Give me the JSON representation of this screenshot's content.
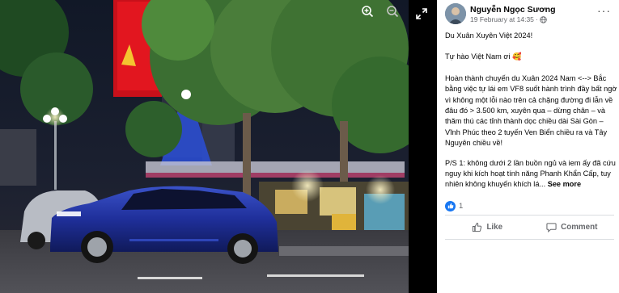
{
  "photo": {
    "icons": [
      "zoom-in-icon",
      "zoom-out-icon",
      "expand-icon"
    ]
  },
  "post": {
    "author": "Nguyễn Ngọc Sương",
    "date": "19 February at 14:35",
    "separator": "·",
    "more_label": "···",
    "paragraphs": [
      "Du Xuân Xuyên Việt 2024!",
      "Tự hào Việt Nam ơi 🥰",
      "Hoàn thành chuyến du Xuân 2024 Nam <--> Bắc bằng việc tự lái em VF8 suốt hành trình đầy bất ngờ vì không một lỗi nào trên cả chặng đường đi lẫn về đâu đó > 3.500 km, xuyên qua – dừng chân – và thăm thú các tỉnh thành dọc chiều dài Sài Gòn – Vĩnh Phúc theo 2 tuyến Ven Biển chiều ra và Tây Nguyên chiều về!",
      "P/S 1: không dưới 2 lần buồn ngủ và iem ấy đã cứu nguy khi kích hoạt tính năng Phanh Khẩn Cấp, tuy nhiên không khuyến khích lá..."
    ],
    "see_more": "See more",
    "reaction_count": "1",
    "actions": {
      "like": "Like",
      "comment": "Comment"
    }
  },
  "colors": {
    "accent": "#1877f2",
    "secondary_text": "#65676b",
    "divider": "#dadde1"
  }
}
